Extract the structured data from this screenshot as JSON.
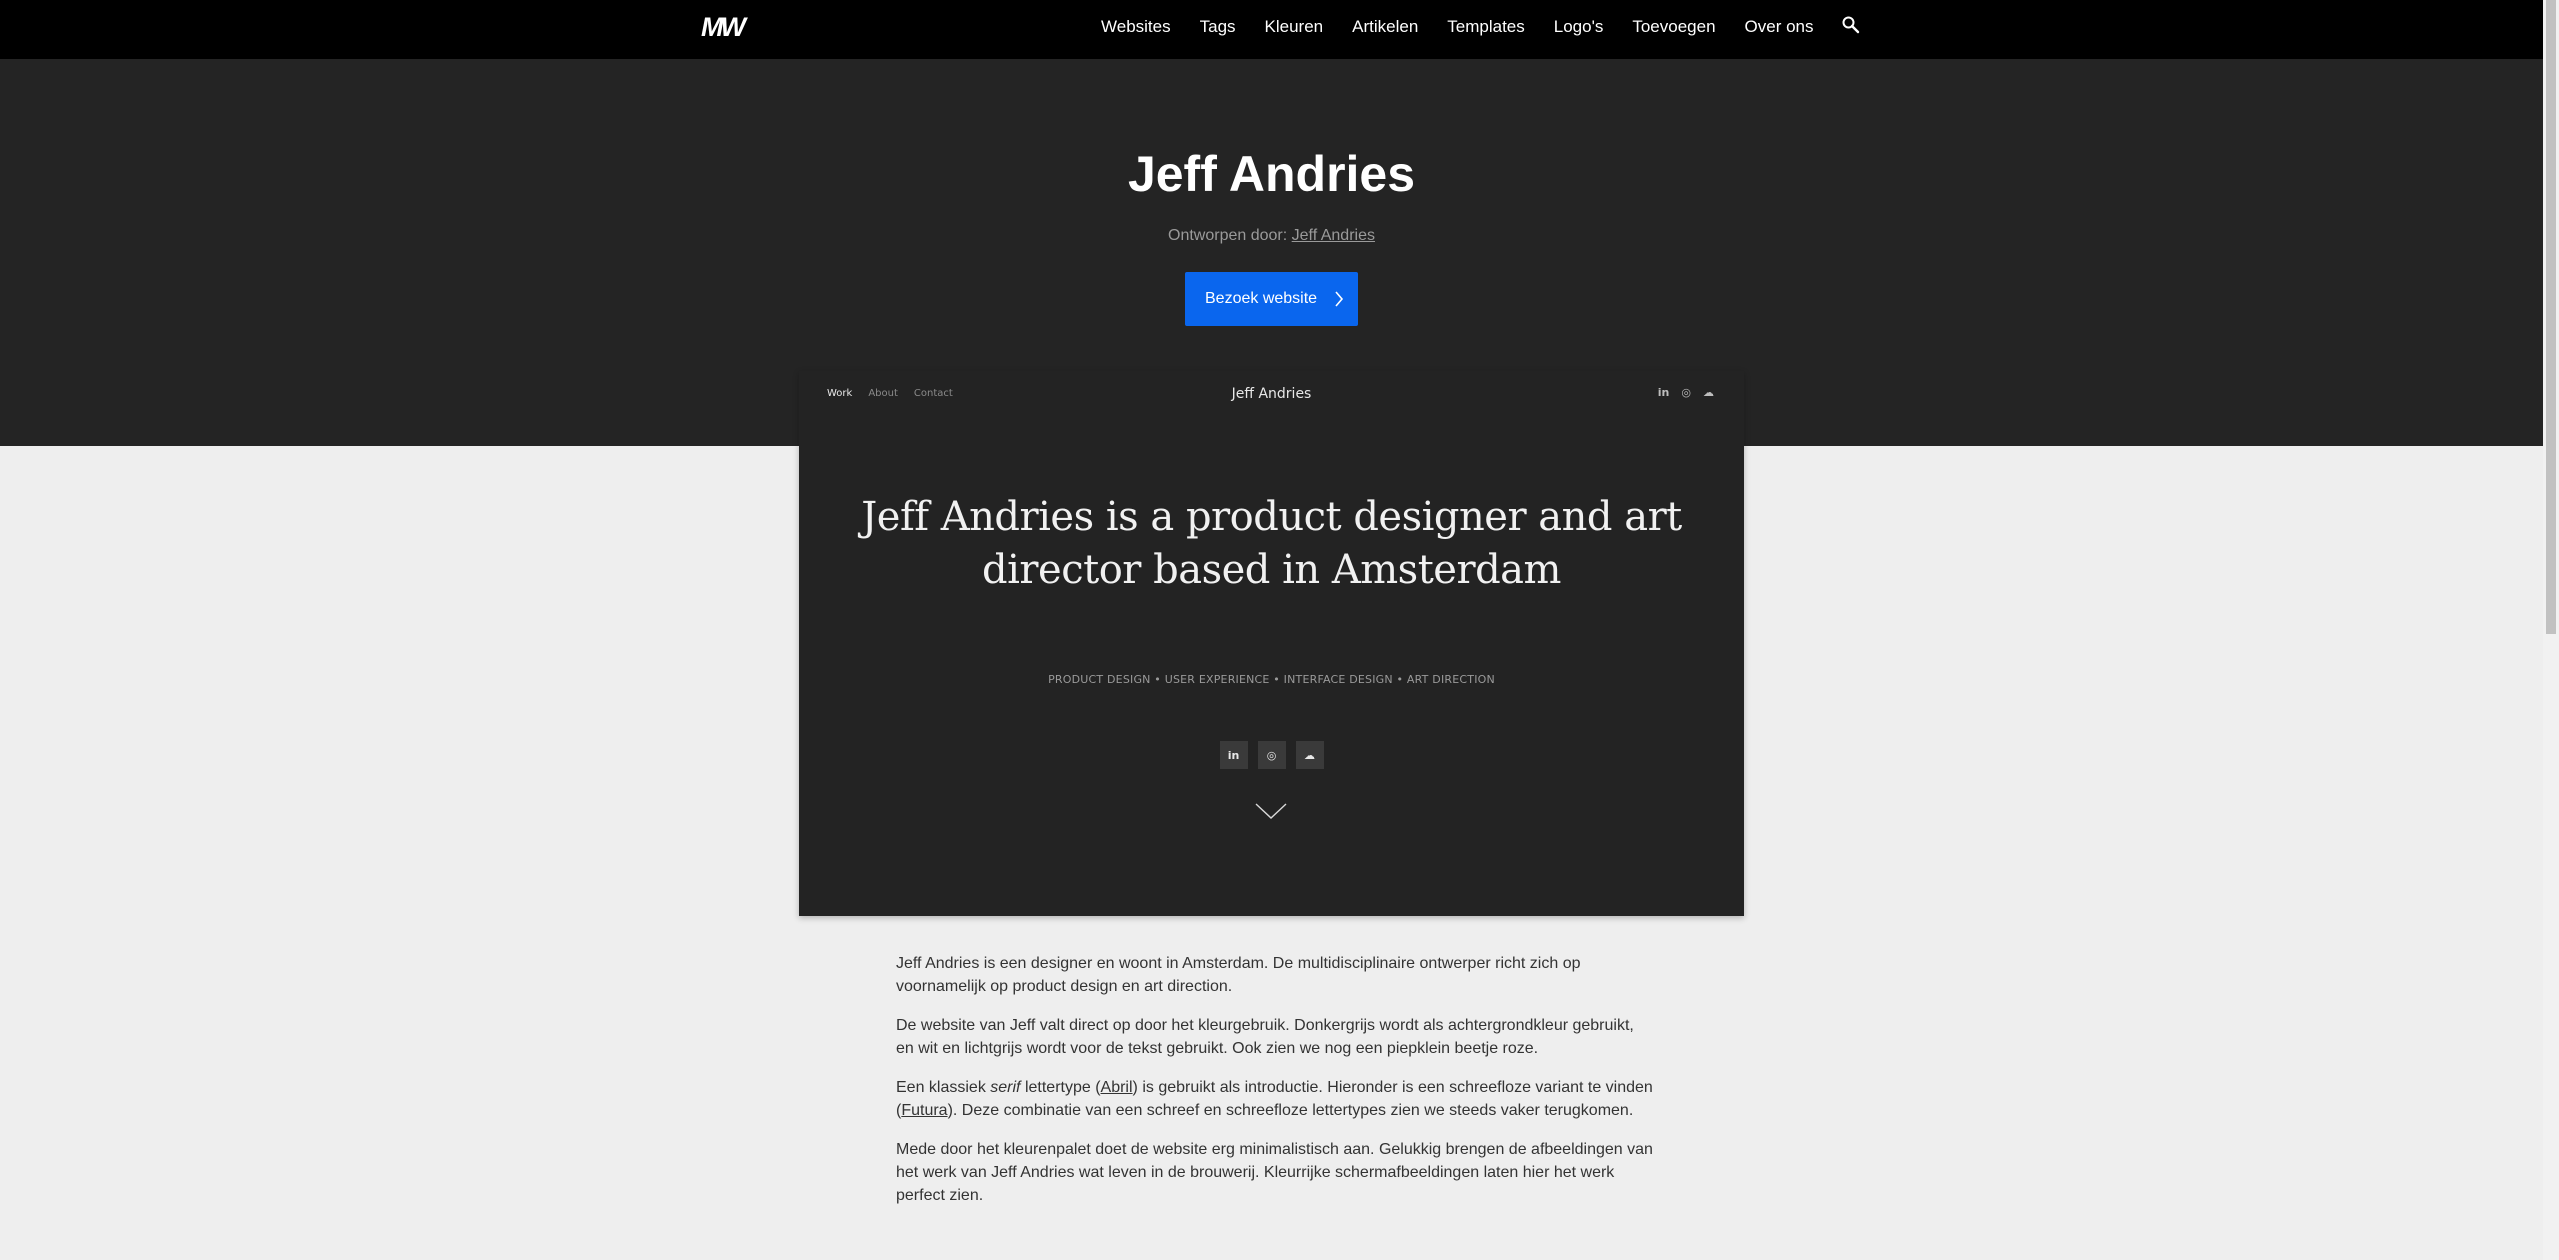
{
  "nav": {
    "logo": "MW",
    "links": [
      "Websites",
      "Tags",
      "Kleuren",
      "Artikelen",
      "Templates",
      "Logo's",
      "Toevoegen",
      "Over ons"
    ],
    "search_icon": "search-icon"
  },
  "hero": {
    "title": "Jeff Andries",
    "designer_label": "Ontworpen door:",
    "designer_name": "Jeff Andries",
    "visit_button": "Bezoek website"
  },
  "preview": {
    "nav": [
      "Work",
      "About",
      "Contact"
    ],
    "brand": "Jeff Andries",
    "top_social": [
      "in",
      "◎",
      "☁"
    ],
    "headline": "Jeff Andries is a product designer and art director based in Amsterdam",
    "tags": "PRODUCT DESIGN • USER EXPERIENCE • INTERFACE DESIGN • ART DIRECTION",
    "social_buttons": [
      "in",
      "◎",
      "☁"
    ],
    "scroll_icon": "chevron-down-icon"
  },
  "article": {
    "p1": "Jeff Andries is een designer en woont in Amsterdam. De multidisciplinaire ontwerper richt zich op voornamelijk op product design en art direction.",
    "p2": "De website van Jeff valt direct op door het kleurgebruik. Donkergrijs wordt als achtergrondkleur gebruikt, en wit en lichtgrijs wordt voor de tekst gebruikt. Ook zien we nog een piepklein beetje roze.",
    "p3_a": "Een klassiek ",
    "p3_em": "serif",
    "p3_b": " lettertype (",
    "p3_link1": "Abril",
    "p3_c": ") is gebruikt als introductie. Hieronder is een schreefloze variant te vinden (",
    "p3_link2": "Futura",
    "p3_d": "). Deze combinatie van een schreef en schreefloze lettertypes zien we steeds vaker terugkomen.",
    "p4": "Mede door het kleurenpalet doet de website erg minimalistisch aan. Gelukkig brengen de afbeeldingen van het werk van Jeff Andries wat leven in de brouwerij. Kleurrijke schermafbeeldingen laten hier het werk perfect zien."
  },
  "colors": {
    "nav_bg": "#000000",
    "hero_bg": "#242424",
    "page_bg": "#eeeeee",
    "button": "#0a66ee"
  }
}
